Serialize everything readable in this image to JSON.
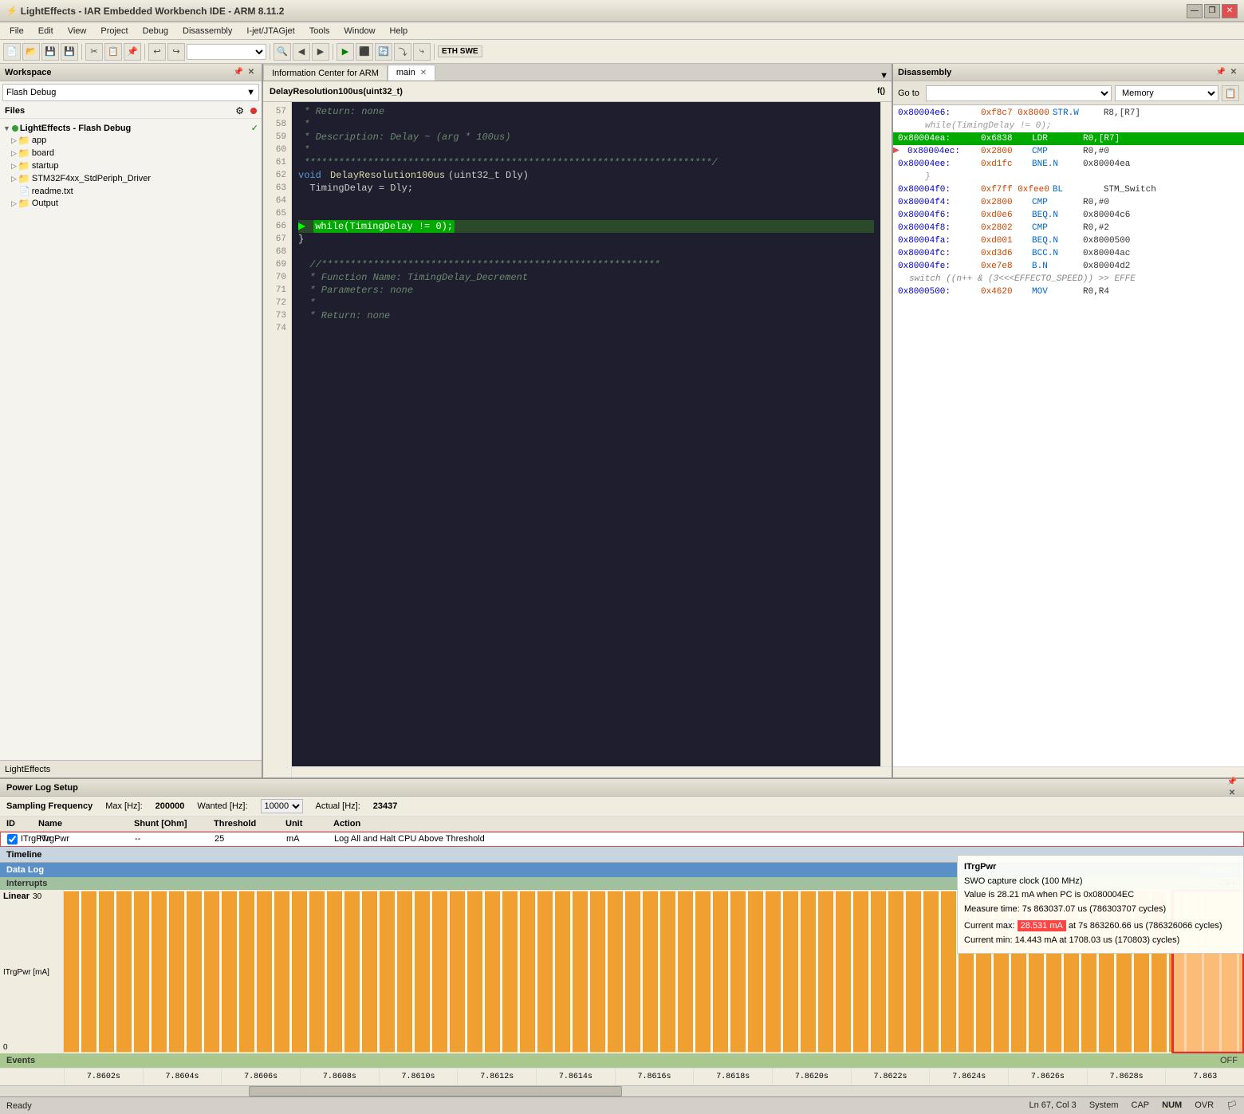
{
  "titlebar": {
    "title": "LightEffects - IAR Embedded Workbench IDE - ARM 8.11.2",
    "icon": "⚡",
    "minimize": "—",
    "restore": "❐",
    "close": "✕"
  },
  "menubar": {
    "items": [
      "File",
      "Edit",
      "View",
      "Project",
      "Debug",
      "Disassembly",
      "I-jet/JTAGjet",
      "Tools",
      "Window",
      "Help"
    ]
  },
  "workspace": {
    "title": "Workspace",
    "dropdown": "Flash Debug",
    "files_label": "Files",
    "tree": [
      {
        "label": "LightEffects - Flash Debug",
        "indent": 0,
        "type": "root",
        "expanded": true
      },
      {
        "label": "app",
        "indent": 1,
        "type": "folder"
      },
      {
        "label": "board",
        "indent": 1,
        "type": "folder"
      },
      {
        "label": "startup",
        "indent": 1,
        "type": "folder"
      },
      {
        "label": "STM32F4xx_StdPeriph_Driver",
        "indent": 1,
        "type": "folder"
      },
      {
        "label": "readme.txt",
        "indent": 2,
        "type": "file"
      },
      {
        "label": "Output",
        "indent": 1,
        "type": "folder"
      }
    ],
    "bottom_label": "LightEffects"
  },
  "tabs": {
    "inactive": "Information Center for ARM",
    "active": "main",
    "dropdown_icon": "▼"
  },
  "code_header": {
    "function": "DelayResolution100us(uint32_t)"
  },
  "code_lines": [
    {
      "num": 57,
      "text": " * Return: none",
      "type": "comment"
    },
    {
      "num": 58,
      "text": " *",
      "type": "comment"
    },
    {
      "num": 59,
      "text": " * Description: Delay ~ (arg * 100us)",
      "type": "comment"
    },
    {
      "num": 60,
      "text": " *",
      "type": "comment"
    },
    {
      "num": 61,
      "text": " *************************************************************/",
      "type": "comment"
    },
    {
      "num": 62,
      "text": "void DelayResolution100us(uint32_t Dly)",
      "type": "code"
    },
    {
      "num": 63,
      "text": "  TimingDelay = Dly;",
      "type": "code"
    },
    {
      "num": 64,
      "text": "",
      "type": "code"
    },
    {
      "num": 65,
      "text": "",
      "type": "code"
    },
    {
      "num": 66,
      "text": "  while(TimingDelay != 0);",
      "type": "current"
    },
    {
      "num": 67,
      "text": "}",
      "type": "code"
    },
    {
      "num": 68,
      "text": "",
      "type": "code"
    },
    {
      "num": 69,
      "text": "  //***********************************************************",
      "type": "comment"
    },
    {
      "num": 70,
      "text": "  * Function Name: TimingDelay_Decrement",
      "type": "comment"
    },
    {
      "num": 71,
      "text": "  * Parameters: none",
      "type": "comment"
    },
    {
      "num": 72,
      "text": "  *",
      "type": "comment"
    },
    {
      "num": 73,
      "text": "  * Return: none",
      "type": "comment"
    },
    {
      "num": 74,
      "text": "",
      "type": "code"
    }
  ],
  "disassembly": {
    "title": "Disassembly",
    "goto_label": "Go to",
    "memory_label": "Memory",
    "rows": [
      {
        "addr": "0x80004e6:",
        "hex": "0xf8c7 0x8000",
        "instr": "STR.W",
        "ops": "R8,[R7]",
        "type": "normal"
      },
      {
        "text": "while(TimingDelay != 0);",
        "type": "comment"
      },
      {
        "addr": "0x80004ea:",
        "hex": "0x6838",
        "instr": "LDR",
        "ops": "R0,[R7]",
        "type": "highlighted"
      },
      {
        "addr": "0x80004ec:",
        "hex": "0x2800",
        "instr": "CMP",
        "ops": "R0,#0",
        "type": "normal"
      },
      {
        "addr": "0x80004ee:",
        "hex": "0xd1fc",
        "instr": "BNE.N",
        "ops": "0x80004ea",
        "type": "normal"
      },
      {
        "text": "}",
        "type": "comment2"
      },
      {
        "addr": "0x80004f0:",
        "hex": "0xf7ff 0xfee0",
        "instr": "BL",
        "ops": "STM_Switch",
        "type": "normal"
      },
      {
        "addr": "0x80004f4:",
        "hex": "0x2800",
        "instr": "CMP",
        "ops": "R0,#0",
        "type": "normal"
      },
      {
        "addr": "0x80004f6:",
        "hex": "0xd0e6",
        "instr": "BEQ.N",
        "ops": "0x80004c6",
        "type": "normal"
      },
      {
        "addr": "0x80004f8:",
        "hex": "0x2802",
        "instr": "CMP",
        "ops": "R0,#2",
        "type": "normal"
      },
      {
        "addr": "0x80004fa:",
        "hex": "0xd001",
        "instr": "BEQ.N",
        "ops": "0x8000500",
        "type": "normal"
      },
      {
        "addr": "0x80004fc:",
        "hex": "0xd3d6",
        "instr": "BCC.N",
        "ops": "0x80004ac",
        "type": "normal"
      },
      {
        "addr": "0x80004fe:",
        "hex": "0xe7e8",
        "instr": "B.N",
        "ops": "0x80004d2",
        "type": "normal"
      },
      {
        "text": "switch ((n++ & (3<<<EFFECTO_SPEED)) >> EFFE",
        "type": "comment3"
      },
      {
        "addr": "0x8000500:",
        "hex": "0x4620",
        "instr": "MOV",
        "ops": "R0,R4",
        "type": "normal"
      }
    ]
  },
  "powerlog": {
    "title": "Power Log Setup",
    "sampling": {
      "label": "Sampling Frequency",
      "max_label": "Max [Hz]:",
      "max_value": "200000",
      "wanted_label": "Wanted [Hz]:",
      "wanted_value": "10000",
      "actual_label": "Actual [Hz]:",
      "actual_value": "23437"
    },
    "table_headers": [
      "ID",
      "Name",
      "Shunt [Ohm]",
      "Threshold",
      "Unit",
      "Action"
    ],
    "row": {
      "checkbox": true,
      "id": "ITrgPwr",
      "name": "ITrgPwr",
      "shunt": "--",
      "threshold": "25",
      "unit": "mA",
      "action": "Log All and Halt CPU Above Threshold"
    },
    "tooltip": {
      "title": "ITrgPwr",
      "line1": "SWO capture clock (100 MHz)",
      "line2": "Value is 28.21 mA when PC is 0x080004EC",
      "line3": "Measure time: 7s 863037.07 us (786303707 cycles)",
      "current_max_label": "Current max: ",
      "current_max_value": "28.531 mA",
      "current_max_suffix": " at 7s 863260.66 us (786326066 cycles)",
      "current_min": "Current min: 14.443 mA at 1708.03 us (170803) cycles)"
    },
    "timeline_label": "Timeline",
    "datalog_label": "Data Log",
    "datalog_value": "<no data>",
    "interrupts_label": "Interrupts",
    "interrupts_value": "OFF",
    "linear_label": "Linear",
    "linear_max": "30",
    "linear_unit": "ITrgPwr [mA]",
    "linear_min": "0",
    "events_label": "Events",
    "events_value": "OFF",
    "time_ticks": [
      "7.8602s",
      "7.8604s",
      "7.8606s",
      "7.8608s",
      "7.8610s",
      "7.8612s",
      "7.8614s",
      "7.8616s",
      "7.8618s",
      "7.8620s",
      "7.8622s",
      "7.8624s",
      "7.8626s",
      "7.8628s",
      "7.863"
    ]
  },
  "statusbar": {
    "ready": "Ready",
    "position": "Ln 67, Col 3",
    "system": "System",
    "cap": "CAP",
    "num": "NUM",
    "ovr": "OVR"
  }
}
